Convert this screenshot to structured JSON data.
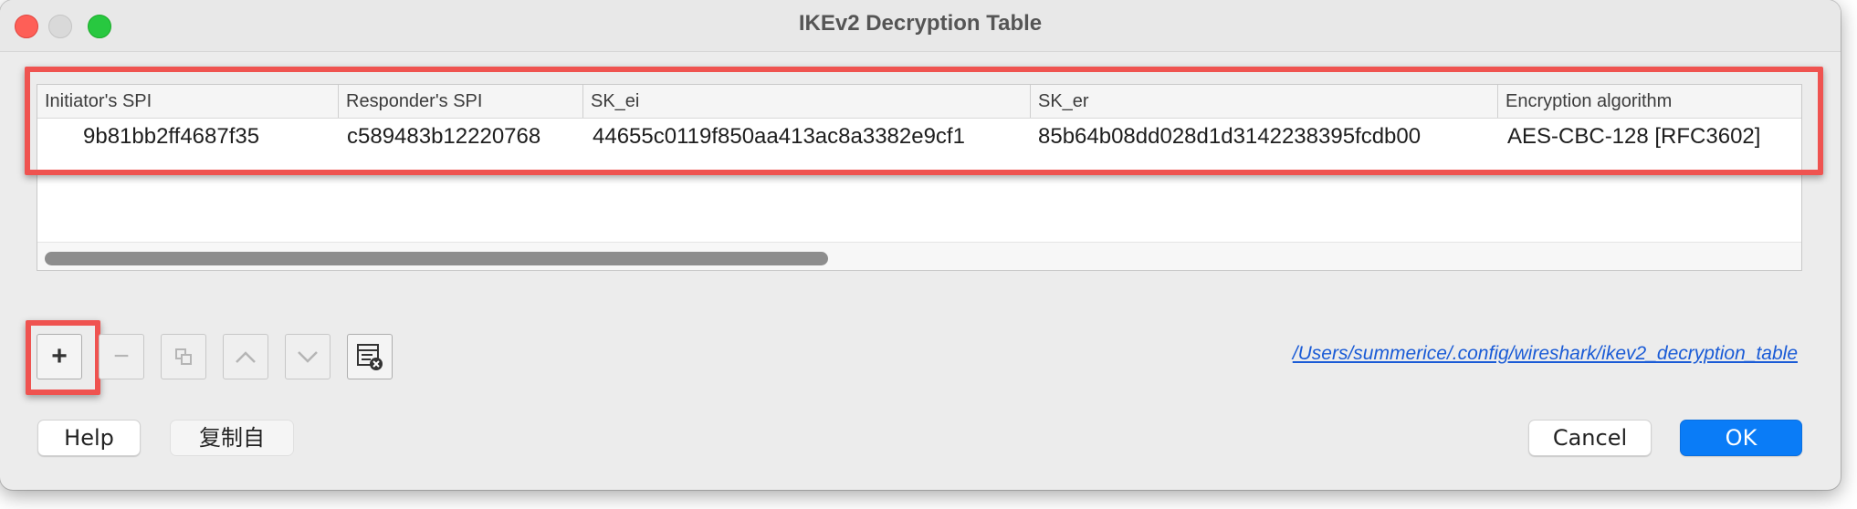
{
  "window": {
    "title": "IKEv2 Decryption Table"
  },
  "table": {
    "columns": [
      "Initiator's SPI",
      "Responder's SPI",
      "SK_ei",
      "SK_er",
      "Encryption algorithm"
    ],
    "rows": [
      {
        "initiator_spi": "9b81bb2ff4687f35",
        "responder_spi": "c589483b12220768",
        "sk_ei": "44655c0119f850aa413ac8a3382e9cf1",
        "sk_er": "85b64b08dd028d1d3142238395fcdb00",
        "encryption_algorithm": "AES-CBC-128 [RFC3602]"
      }
    ]
  },
  "toolbar": {
    "add_label": "+",
    "remove_label": "−",
    "file_path": "/Users/summerice/.config/wireshark/ikev2_decryption_table"
  },
  "buttons": {
    "help": "Help",
    "copy_from": "复制自",
    "cancel": "Cancel",
    "ok": "OK"
  },
  "colors": {
    "highlight": "#ef5350",
    "link": "#1a5bd6",
    "primary_button": "#0a7cf7"
  }
}
